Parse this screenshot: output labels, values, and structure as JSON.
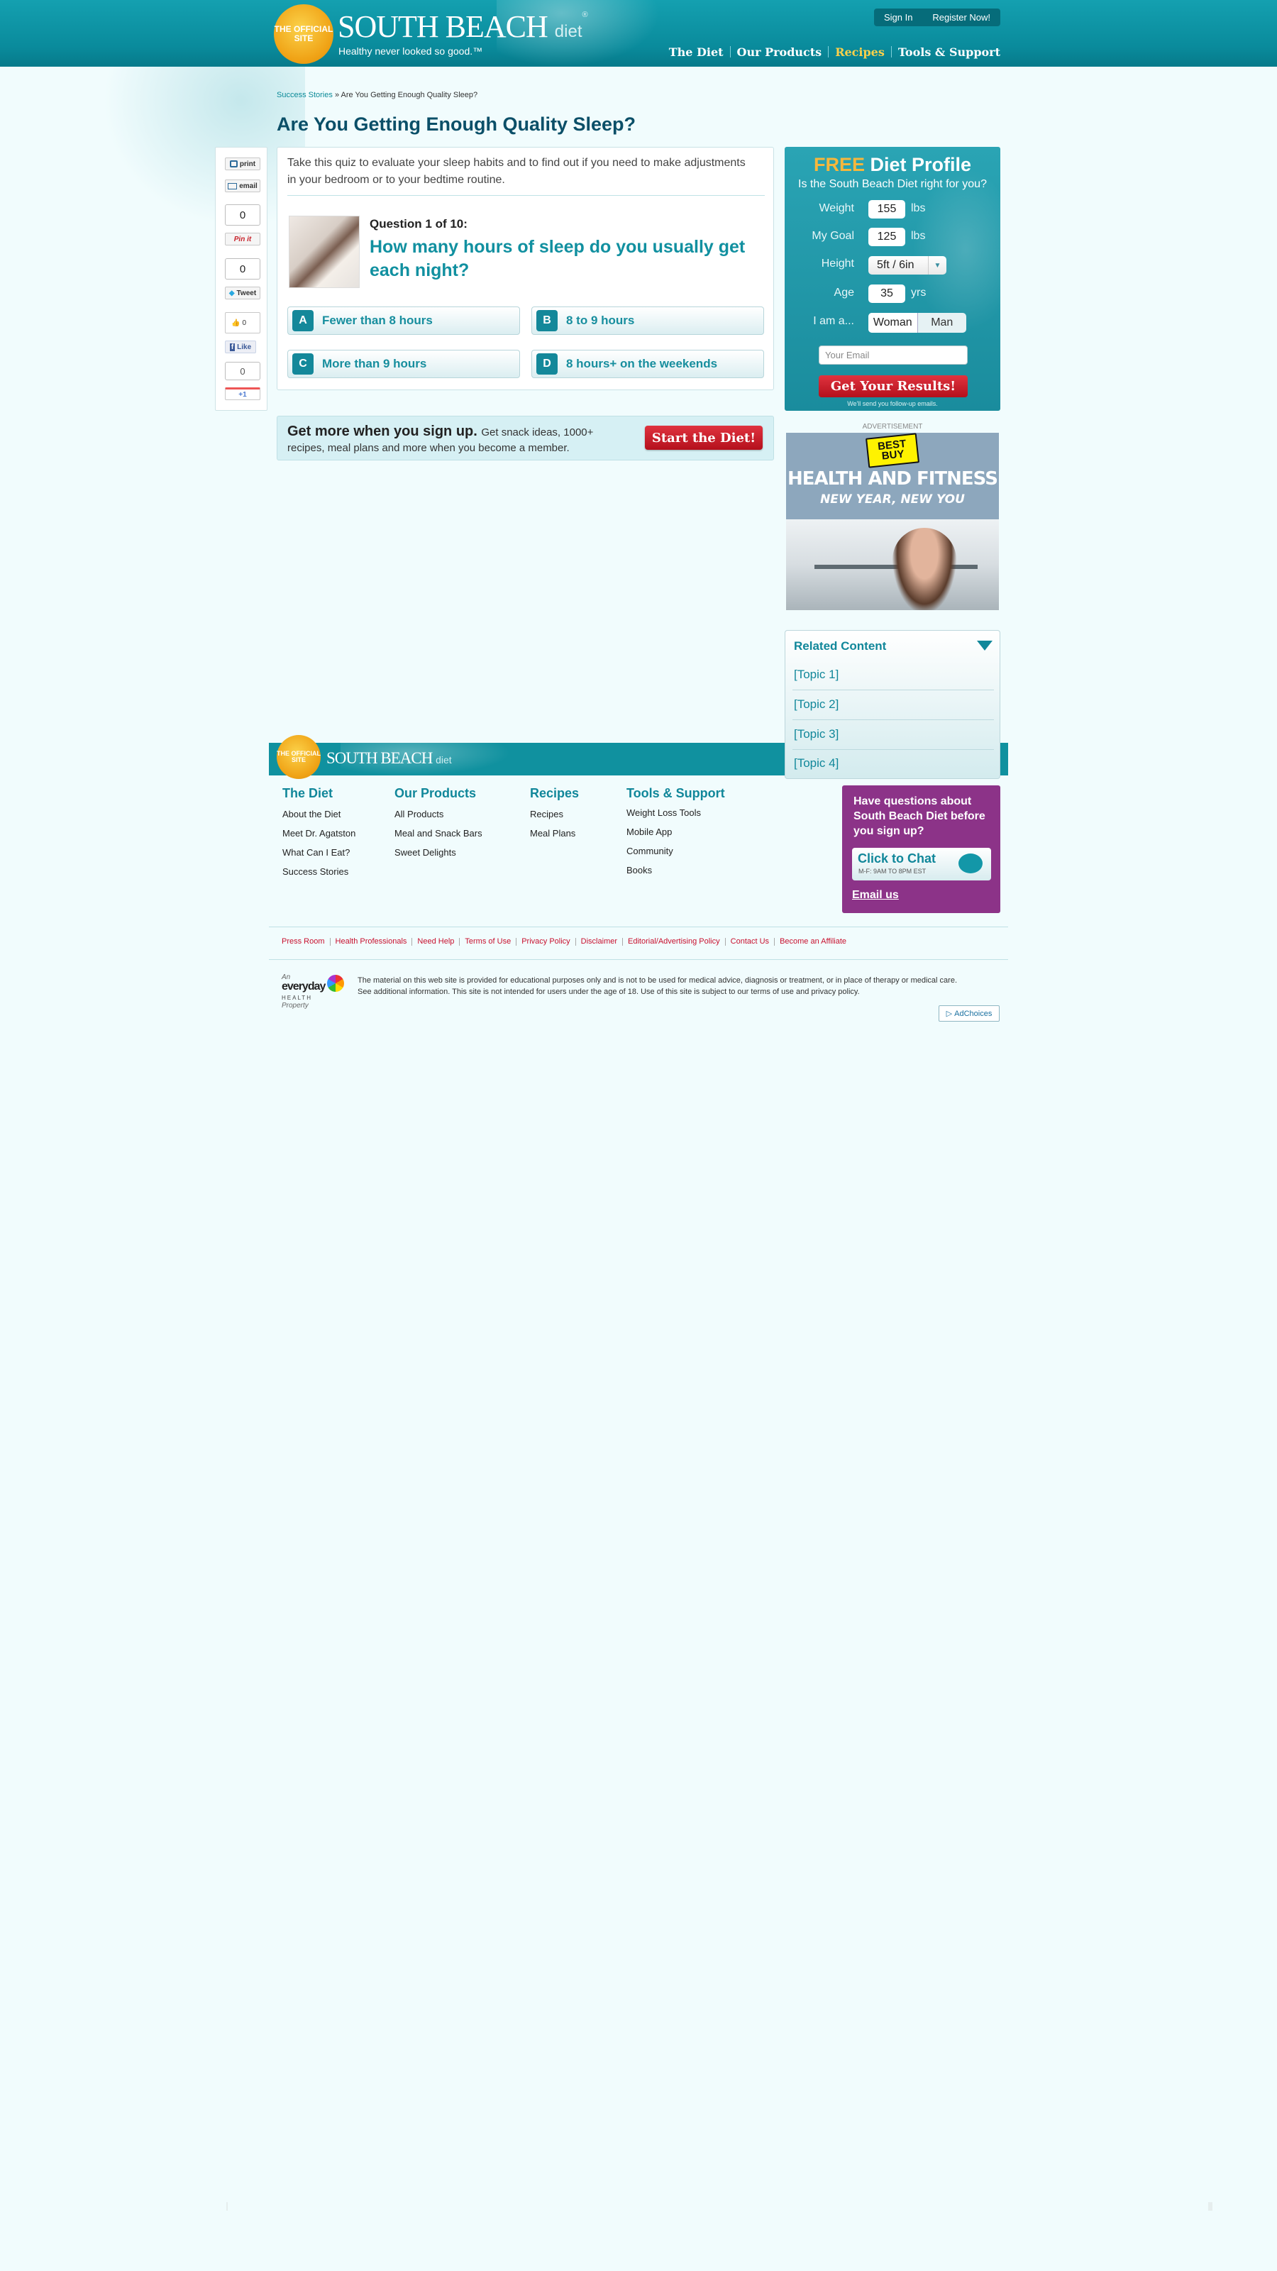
{
  "header": {
    "seal_text": "THE OFFICIAL SITE",
    "logo_main": "SOUTH BEACH",
    "logo_sub": "diet",
    "logo_tm": "®",
    "tagline": "Healthy never looked so good.™",
    "sign_in": "Sign In",
    "register": "Register Now!",
    "nav": [
      "The Diet",
      "Our Products",
      "Recipes",
      "Tools & Support"
    ],
    "active_nav": "Recipes"
  },
  "breadcrumb": {
    "parent": "Success Stories",
    "separator": "»",
    "current": "Are You Getting Enough Quality Sleep?"
  },
  "page_title": "Are You Getting Enough Quality Sleep?",
  "share": {
    "print": "print",
    "email": "email",
    "email_count": "0",
    "pinit": "Pin it",
    "pin_count": "0",
    "tweet": "Tweet",
    "like_count": "0",
    "like": "Like",
    "gplus_count": "0",
    "gplus": "+1"
  },
  "quiz": {
    "intro": "Take this quiz to evaluate your sleep habits and to find out if you need to make adjustments in your bedroom or to your bedtime routine.",
    "question_number": "Question 1 of 10:",
    "question": "How many hours of sleep do you usually get each night?",
    "answers": [
      {
        "letter": "A",
        "text": "Fewer than 8 hours"
      },
      {
        "letter": "B",
        "text": "8 to 9 hours"
      },
      {
        "letter": "C",
        "text": "More than 9 hours"
      },
      {
        "letter": "D",
        "text": "8 hours+ on the weekends"
      }
    ]
  },
  "signup": {
    "headline": "Get more when you sign up.",
    "line1_rest": "Get snack ideas, 1000+",
    "line2": "recipes, meal plans and more when you become a member.",
    "button": "Start the Diet!"
  },
  "profile": {
    "title_free": "FREE",
    "title_rest": "Diet Profile",
    "subtitle": "Is the South Beach Diet right for you?",
    "weight_label": "Weight",
    "weight_value": "155",
    "weight_unit": "lbs",
    "goal_label": "My Goal",
    "goal_value": "125",
    "goal_unit": "lbs",
    "height_label": "Height",
    "height_value": "5ft / 6in",
    "age_label": "Age",
    "age_value": "35",
    "age_unit": "yrs",
    "sex_label": "I am a...",
    "sex_options": [
      "Woman",
      "Man"
    ],
    "email_placeholder": "Your Email",
    "button": "Get Your Results!",
    "note": "We'll send you follow-up emails."
  },
  "ad": {
    "label": "ADVERTISEMENT",
    "brand": "BEST BUY",
    "headline": "HEALTH AND FITNESS",
    "subhead": "NEW YEAR, NEW YOU"
  },
  "related": {
    "title": "Related Content",
    "items": [
      "[Topic 1]",
      "[Topic 2]",
      "[Topic 3]",
      "[Topic 4]"
    ]
  },
  "footer": {
    "seal_text": "THE OFFICIAL SITE",
    "logo_main": "SOUTH BEACH",
    "logo_sub": "diet",
    "columns": [
      {
        "title": "The Diet",
        "links": [
          "About the Diet",
          "Meet Dr. Agatston",
          "What Can I Eat?",
          "Success Stories"
        ]
      },
      {
        "title": "Our Products",
        "links": [
          "All Products",
          "Meal and Snack Bars",
          "Sweet Delights"
        ]
      },
      {
        "title": "Recipes",
        "links": [
          "Recipes",
          "Meal Plans"
        ]
      },
      {
        "title": "Tools & Support",
        "links": [
          "Weight Loss Tools",
          "Mobile App",
          "Community",
          "Books"
        ]
      }
    ],
    "chat": {
      "heading": "Have questions about South Beach Diet before you sign up?",
      "button": "Click to Chat",
      "hours": "M-F: 9AM TO 8PM EST",
      "email": "Email us"
    },
    "legal_links": [
      "Press Room",
      "Health Professionals",
      "Need Help",
      "Terms of Use",
      "Privacy Policy",
      "Disclaimer",
      "Editorial/Advertising Policy",
      "Contact Us",
      "Become an Affiliate"
    ],
    "everyday": {
      "an": "An",
      "brand": "everyday",
      "health": "HEALTH",
      "property": "Property"
    },
    "disclaimer": "The material on this web site is provided for educational purposes only and is not to be used for medical advice, diagnosis or treatment, or in place of therapy or medical care. See additional information. This site is not intended for users under the age of 18. Use of this site is subject to our terms of use and privacy policy.",
    "adchoices": "AdChoices"
  },
  "colors": {
    "header_teal": "#0a8b9c",
    "accent_teal": "#11879a",
    "title_navy": "#0b4f68",
    "button_red": "#c8102e",
    "nav_active": "#fcd04a",
    "chat_purple": "#8c3388"
  }
}
